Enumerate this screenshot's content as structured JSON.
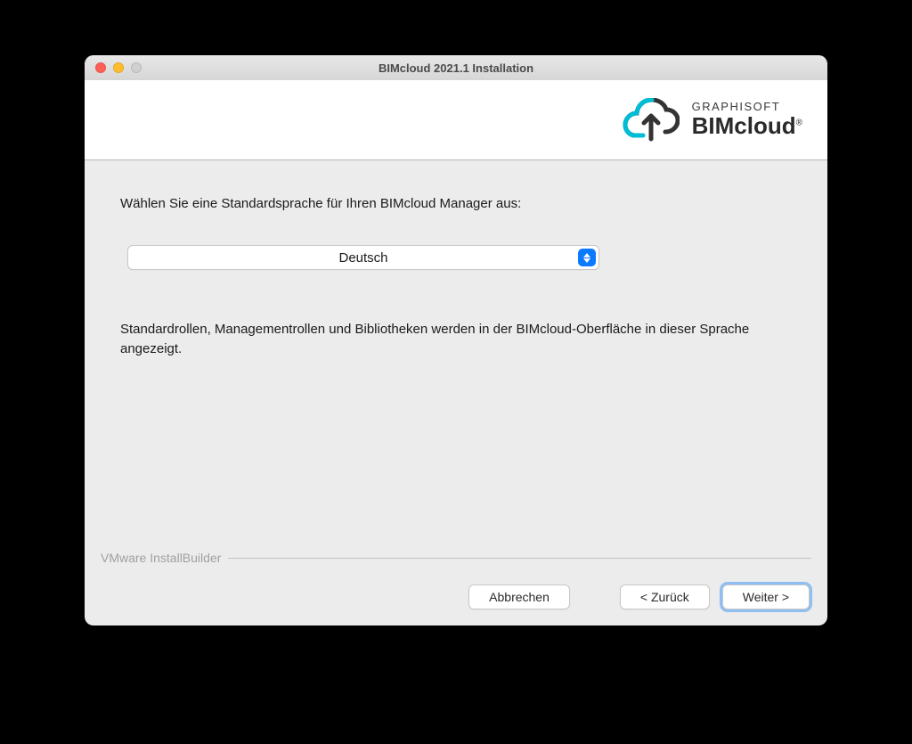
{
  "window": {
    "title": "BIMcloud 2021.1 Installation"
  },
  "brand": {
    "company": "GRAPHISOFT",
    "product": "BIMcloud",
    "registered": "®"
  },
  "content": {
    "instruction": "Wählen Sie eine Standardsprache für Ihren BIMcloud Manager aus:",
    "selectedLanguage": "Deutsch",
    "description": "Standardrollen, Managementrollen und Bibliotheken werden in der BIMcloud-Oberfläche in dieser Sprache angezeigt."
  },
  "footer": {
    "builder": "VMware InstallBuilder",
    "cancel": "Abbrechen",
    "back": "< Zurück",
    "next": "Weiter >"
  }
}
